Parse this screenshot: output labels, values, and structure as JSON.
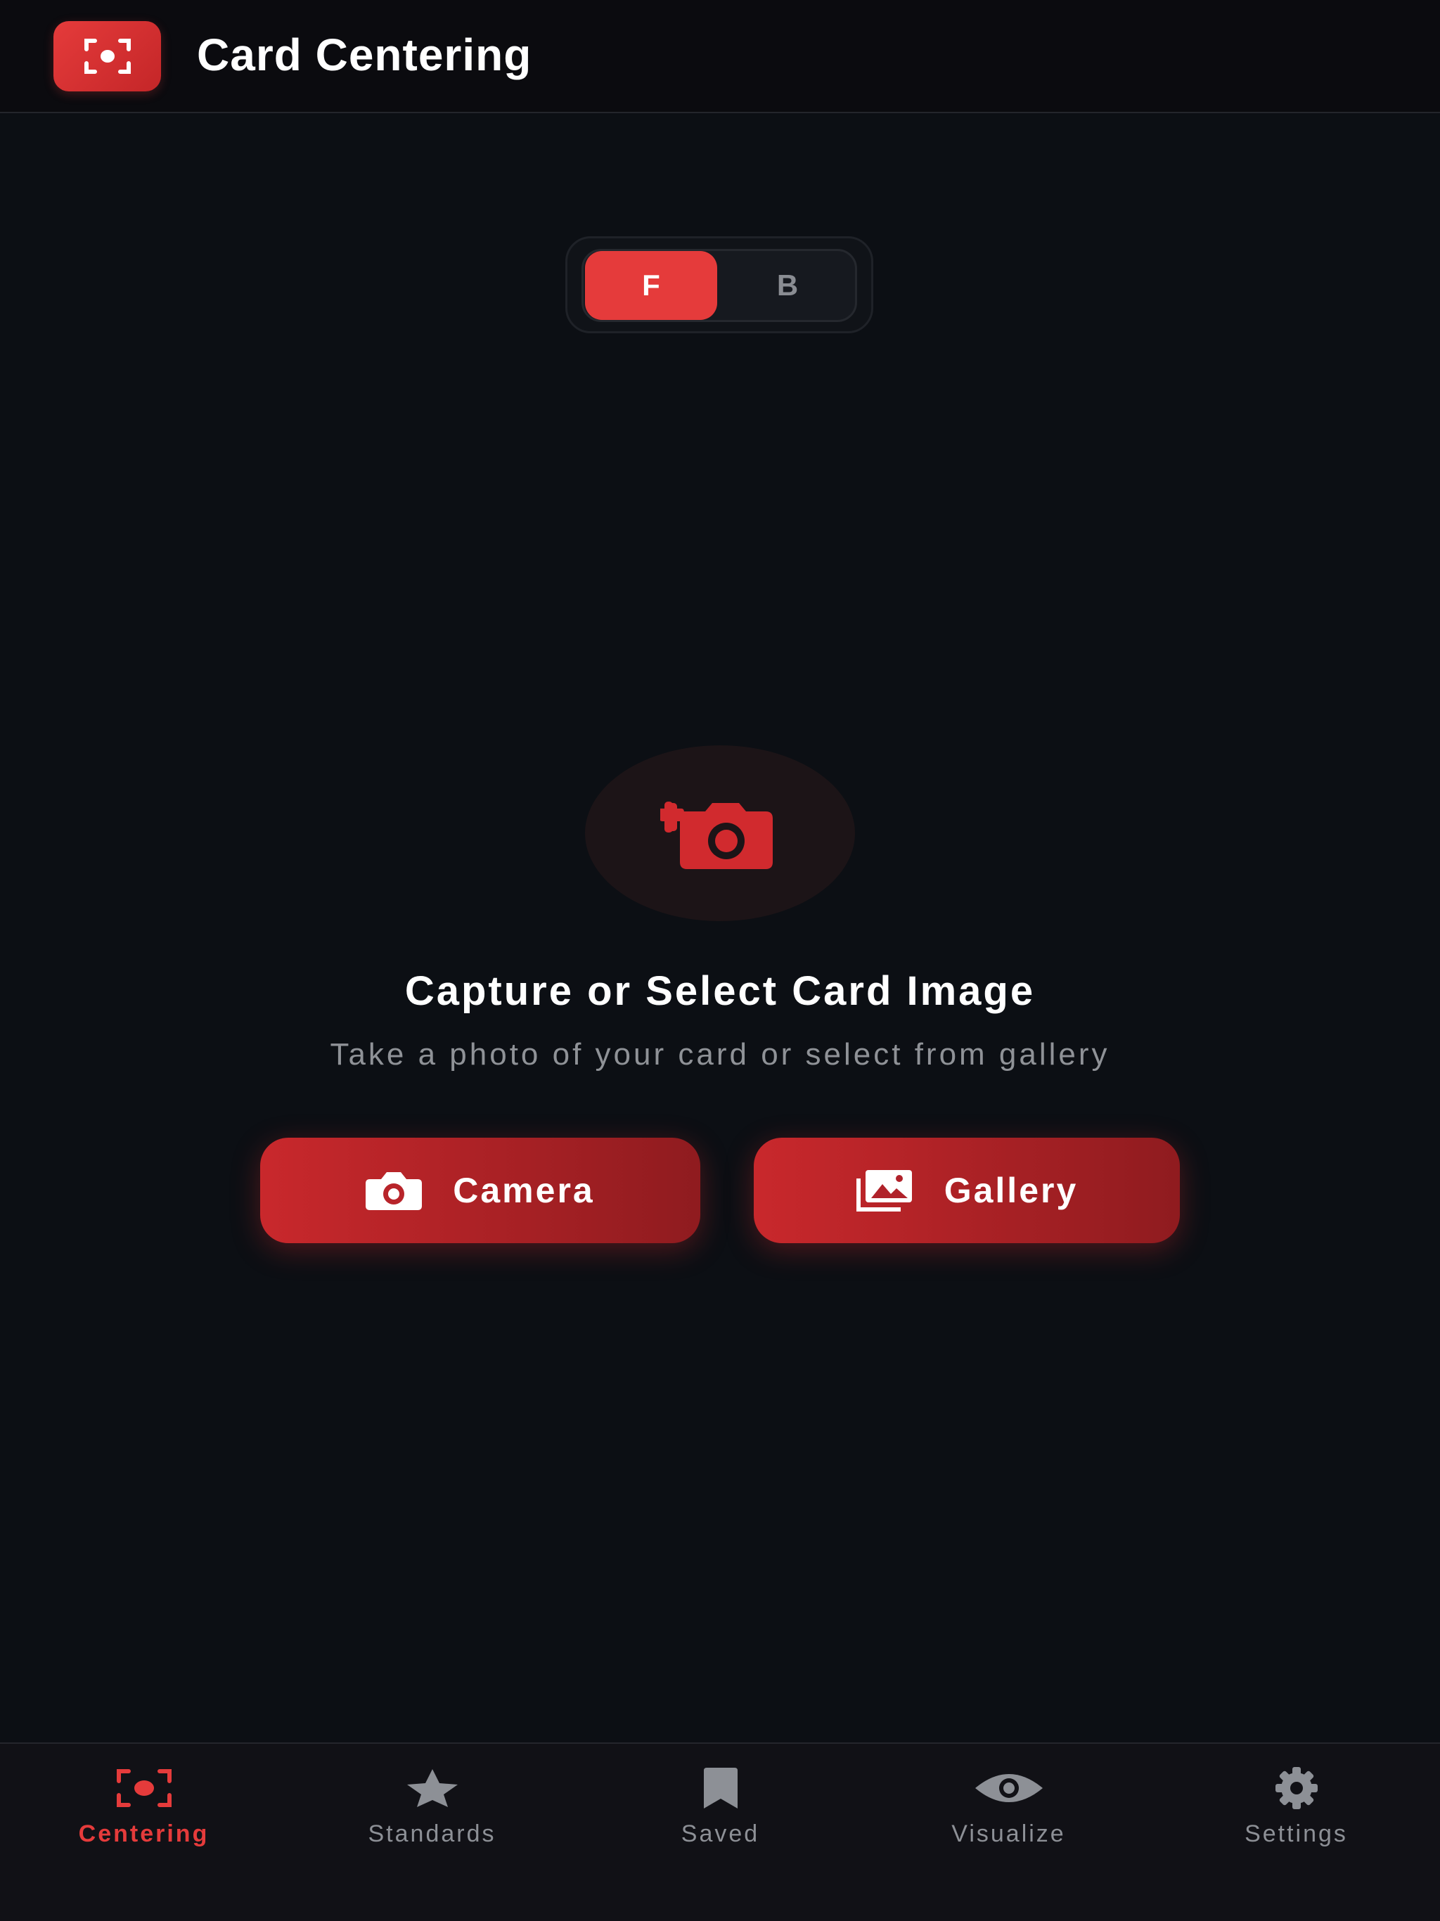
{
  "header": {
    "title": "Card Centering",
    "logo_icon": "focus-center-icon"
  },
  "side_toggle": {
    "options": [
      {
        "label": "F",
        "selected": true
      },
      {
        "label": "B",
        "selected": false
      }
    ]
  },
  "empty_state": {
    "icon": "camera-plus-icon",
    "title": "Capture or Select Card Image",
    "subtitle": "Take a photo of your card or select from gallery"
  },
  "actions": {
    "camera_label": "Camera",
    "gallery_label": "Gallery"
  },
  "bottom_nav": {
    "items": [
      {
        "label": "Centering",
        "icon": "focus-center-icon",
        "active": true
      },
      {
        "label": "Standards",
        "icon": "star-icon",
        "active": false
      },
      {
        "label": "Saved",
        "icon": "bookmark-icon",
        "active": false
      },
      {
        "label": "Visualize",
        "icon": "eye-icon",
        "active": false
      },
      {
        "label": "Settings",
        "icon": "gear-icon",
        "active": false
      }
    ]
  },
  "colors": {
    "accent": "#e53b3b",
    "background": "#0c0f14",
    "nav_inactive": "#8d9096"
  }
}
